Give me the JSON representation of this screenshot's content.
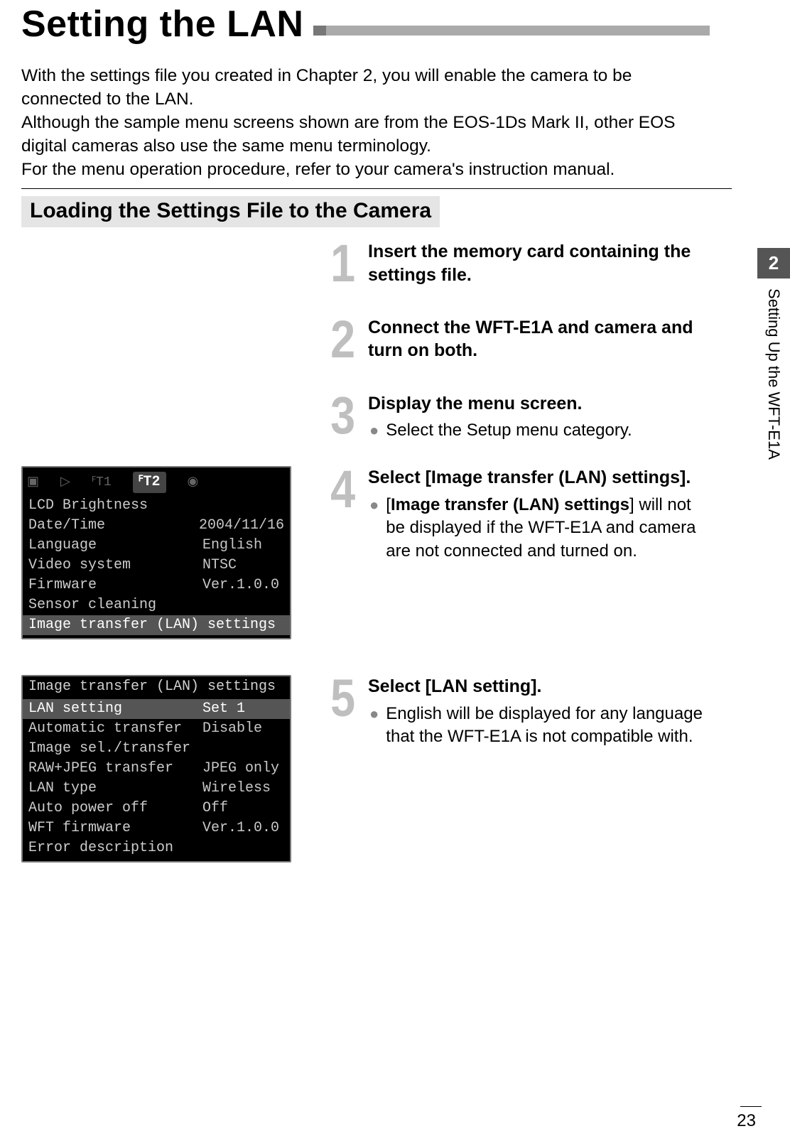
{
  "title": "Setting the LAN",
  "intro_p1": "With the settings file you created in Chapter 2, you will enable the camera to be connected to the LAN.",
  "intro_p2": "Although the sample menu screens shown are from the EOS-1Ds Mark II, other EOS digital cameras also use the same menu terminology.",
  "intro_p3": "For the menu operation procedure, refer to your camera's instruction manual.",
  "section_heading": "Loading the Settings File to the Camera",
  "chapter_tab_num": "2",
  "chapter_tab_label": "Setting Up the WFT-E1A",
  "page_number": "23",
  "steps": {
    "s1": {
      "num": "1",
      "title": "Insert the memory card containing the settings file."
    },
    "s2": {
      "num": "2",
      "title": "Connect the WFT-E1A and camera and turn on both."
    },
    "s3": {
      "num": "3",
      "title": "Display the menu screen.",
      "bullet1": "Select the Setup menu category."
    },
    "s4": {
      "num": "4",
      "title": "Select [Image transfer (LAN) settings].",
      "bullet_pre": "[",
      "bullet_bold": "Image transfer (LAN) settings",
      "bullet_post": "] will not be displayed if the WFT-E1A and camera are not connected and turned on."
    },
    "s5": {
      "num": "5",
      "title": "Select [LAN setting].",
      "bullet1": "English will be displayed for any language that the WFT-E1A is not compatible with."
    }
  },
  "figure1": {
    "active_tab": "ꟳT2",
    "rows": [
      {
        "label": "LCD Brightness",
        "value": ""
      },
      {
        "label": "Date/Time",
        "value": "2004/11/16"
      },
      {
        "label": "Language",
        "value": "English"
      },
      {
        "label": "Video system",
        "value": "NTSC"
      },
      {
        "label": "Firmware",
        "value": "Ver.1.0.0"
      },
      {
        "label": "Sensor cleaning",
        "value": ""
      }
    ],
    "highlight_row": "Image transfer (LAN) settings"
  },
  "figure2": {
    "header": "Image transfer (LAN) settings",
    "highlight": {
      "label": "LAN setting",
      "value": "Set 1"
    },
    "rows": [
      {
        "label": "Automatic transfer",
        "value": "Disable"
      },
      {
        "label": "Image sel./transfer",
        "value": ""
      },
      {
        "label": "RAW+JPEG transfer",
        "value": "JPEG only"
      },
      {
        "label": "LAN type",
        "value": "Wireless"
      },
      {
        "label": "Auto power off",
        "value": "Off"
      },
      {
        "label": "WFT firmware",
        "value": "Ver.1.0.0"
      },
      {
        "label": "Error description",
        "value": ""
      }
    ]
  }
}
